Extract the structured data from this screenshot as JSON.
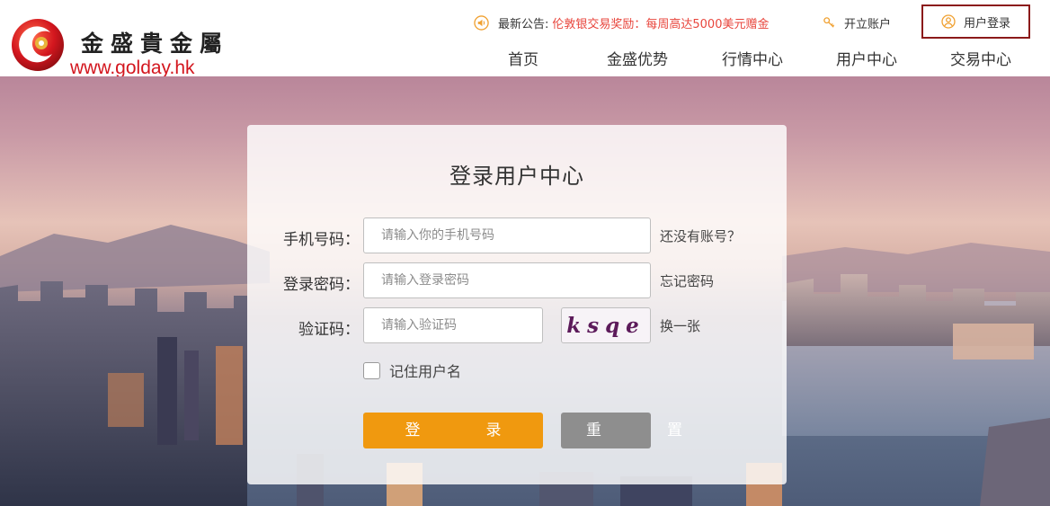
{
  "header": {
    "logo": {
      "cn_name": "金盛貴金屬",
      "url_text": "www.golday.hk"
    },
    "notice": {
      "label": "最新公告:",
      "text": "伦敦银交易奖励：每周高达5000美元赠金",
      "icon": "speaker-icon"
    },
    "open_account": {
      "label": "开立账户",
      "icon": "key-icon"
    },
    "user_login": {
      "label": "用户登录",
      "icon": "user-icon"
    },
    "nav": [
      "首页",
      "金盛优势",
      "行情中心",
      "用户中心",
      "交易中心"
    ]
  },
  "login_form": {
    "title": "登录用户中心",
    "phone": {
      "label": "手机号码：",
      "placeholder": "请输入你的手机号码",
      "value": "",
      "side_link": "还没有账号？"
    },
    "password": {
      "label": "登录密码：",
      "placeholder": "请输入登录密码",
      "value": "",
      "side_link": "忘记密码"
    },
    "captcha": {
      "label": "验证码：",
      "placeholder": "请输入验证码",
      "value": "",
      "image_text": "ksqe",
      "refresh_link": "换一张"
    },
    "remember": {
      "label": "记住用户名",
      "checked": false
    },
    "login_button": "登　录",
    "reset_button": "重　置"
  },
  "colors": {
    "brand_red": "#d3161e",
    "notice_red": "#e8453c",
    "login_button": "#f0990f",
    "reset_button": "#8e8e8e",
    "login_border": "#8b1a1a"
  }
}
